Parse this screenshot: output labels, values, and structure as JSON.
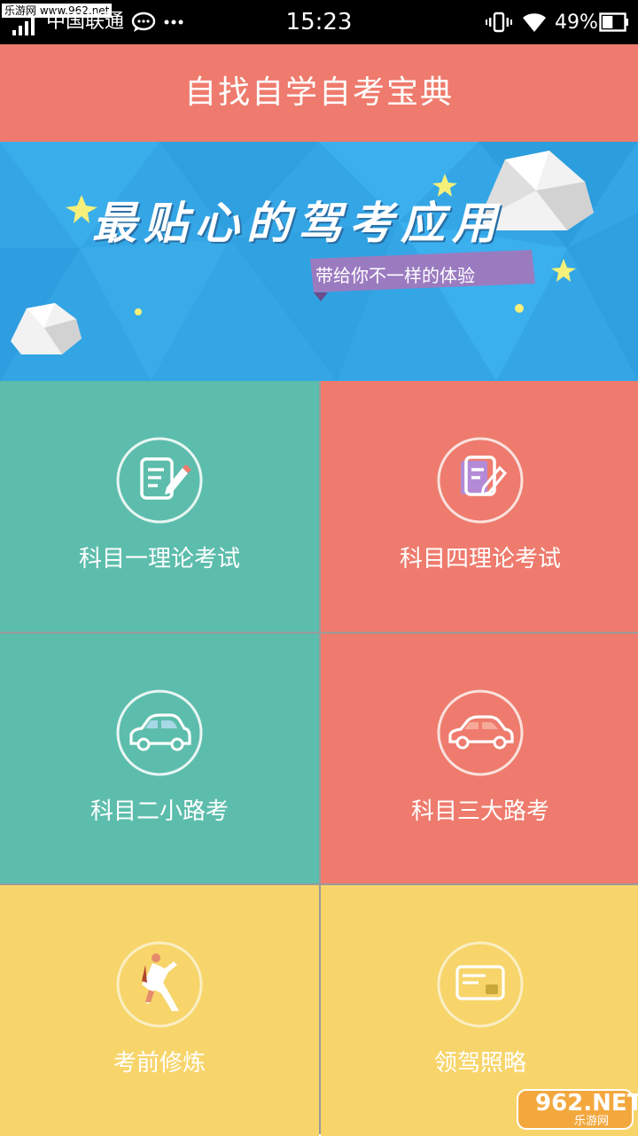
{
  "status_bar": {
    "watermark": "乐游网 www.962.net",
    "carrier": "中国联通",
    "time": "15:23",
    "battery": "49%",
    "battery_level": 0.49
  },
  "header": {
    "title": "自找自学自考宝典"
  },
  "banner": {
    "slogan": "最贴心的驾考应用",
    "tagline": "带给你不一样的体验"
  },
  "tiles": [
    {
      "label": "科目一理论考试",
      "icon": "exam-note-icon"
    },
    {
      "label": "科目四理论考试",
      "icon": "exam-edit-icon"
    },
    {
      "label": "科目二小路考",
      "icon": "small-car-icon"
    },
    {
      "label": "科目三大路考",
      "icon": "car-icon"
    },
    {
      "label": "考前修炼",
      "icon": "exercise-icon"
    },
    {
      "label": "领驾照略",
      "icon": "license-card-icon"
    }
  ],
  "corner_logo": {
    "text": "962.NET",
    "sub": "乐游网"
  },
  "colors": {
    "header": "#EE7B6D",
    "green": "#5DBDAC",
    "red": "#EE7B6D",
    "yellow": "#F7D56B",
    "banner": "#34A6E6"
  }
}
